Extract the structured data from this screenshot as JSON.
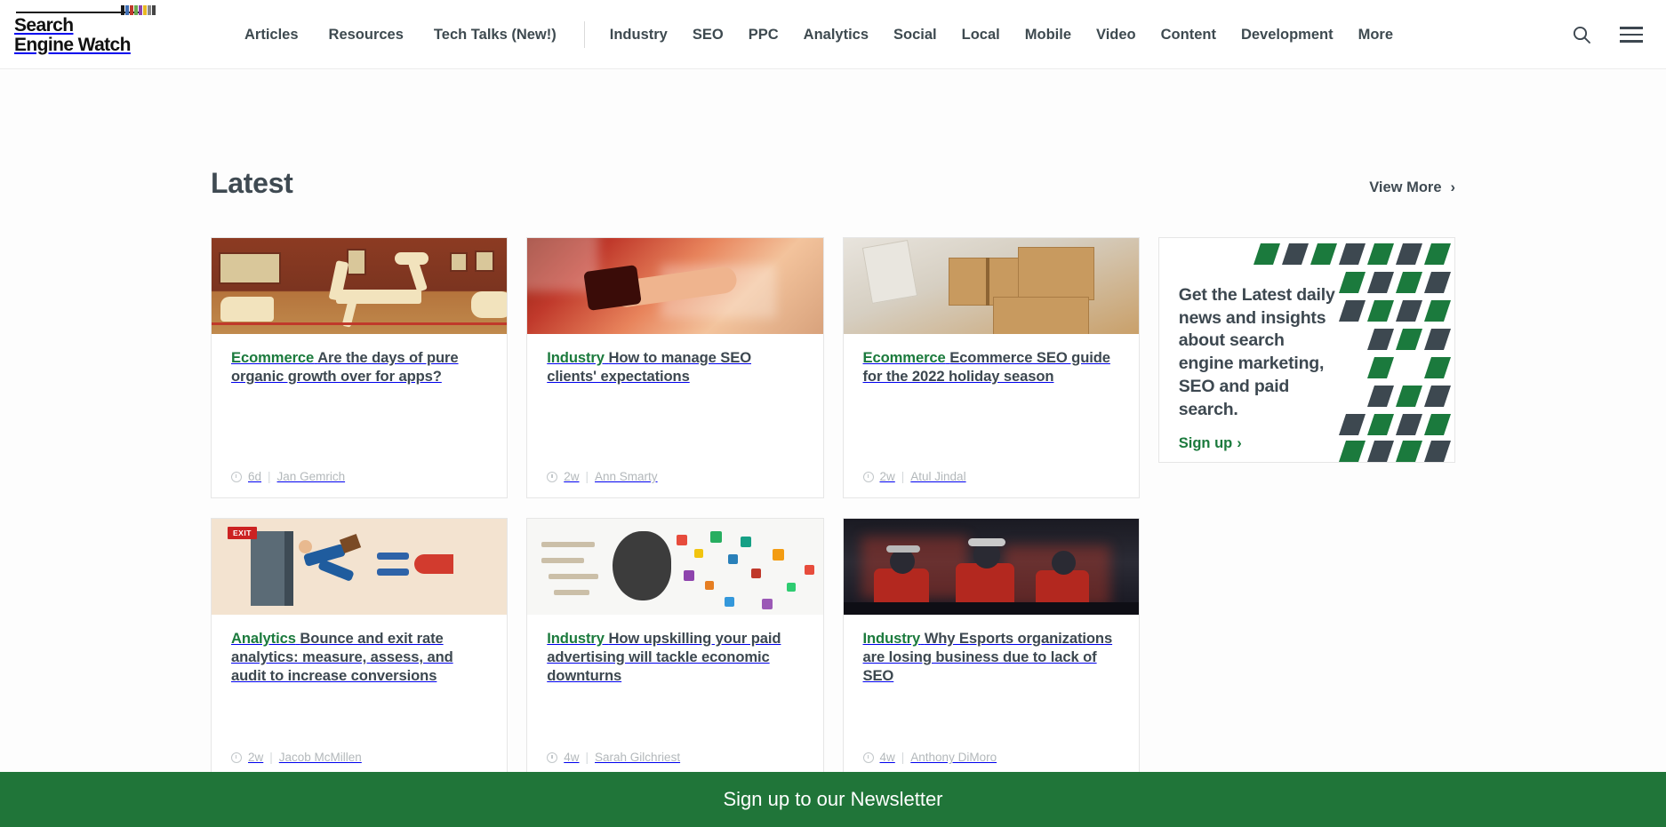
{
  "brand": {
    "name_line1": "Search",
    "name_line2": "Engine Watch",
    "accent_green": "#1b7a3d",
    "bar_colors": [
      "#1a1a1a",
      "#3f6fb5",
      "#c0392b",
      "#6aa84f",
      "#8e44ad",
      "#e8b923",
      "#888888",
      "#444444"
    ]
  },
  "header": {
    "primary_nav": [
      {
        "label": "Articles"
      },
      {
        "label": "Resources"
      },
      {
        "label": "Tech Talks (New!)"
      }
    ],
    "secondary_nav": [
      {
        "label": "Industry"
      },
      {
        "label": "SEO"
      },
      {
        "label": "PPC"
      },
      {
        "label": "Analytics"
      },
      {
        "label": "Social"
      },
      {
        "label": "Local"
      },
      {
        "label": "Mobile"
      },
      {
        "label": "Video"
      },
      {
        "label": "Content"
      },
      {
        "label": "Development"
      },
      {
        "label": "More"
      }
    ],
    "search_icon": "search-icon",
    "menu_icon": "hamburger-icon"
  },
  "main": {
    "section_title": "Latest",
    "view_more_label": "View More",
    "view_more_chevron": "›",
    "cards": [
      {
        "category": "Ecommerce",
        "title": "Are the days of pure organic growth over for apps?",
        "time": "6d",
        "separator": "|",
        "author": "Jan Gemrich",
        "thumb": "museum-dinosaur-skeletons"
      },
      {
        "category": "Industry",
        "title": "How to manage SEO clients' expectations",
        "time": "2w",
        "separator": "|",
        "author": "Ann Smarty",
        "thumb": "business-handshake"
      },
      {
        "category": "Ecommerce",
        "title": "Ecommerce SEO guide for the 2022 holiday season",
        "time": "2w",
        "separator": "|",
        "author": "Atul Jindal",
        "thumb": "cardboard-parcel-boxes"
      },
      {
        "category": "Analytics",
        "title": "Bounce and exit rate analytics: measure, assess, and audit to increase conversions",
        "time": "2w",
        "separator": "|",
        "author": "Jacob McMillen",
        "thumb": "exit-door-magnet-illustration",
        "thumb_badge": "EXIT"
      },
      {
        "category": "Industry",
        "title": "How upskilling your paid advertising will tackle economic downturns",
        "time": "4w",
        "separator": "|",
        "author": "Sarah Gilchriest",
        "thumb": "colorful-brain-ideas"
      },
      {
        "category": "Industry",
        "title": "Why Esports organizations are losing business due to lack of SEO",
        "time": "4w",
        "separator": "|",
        "author": "Anthony DiMoro",
        "thumb": "esports-gaming-team"
      }
    ],
    "promo": {
      "headline": "Get the Latest daily news and insights about search engine marketing, SEO and paid search.",
      "link_label": "Sign up",
      "link_chevron": "›",
      "pattern_colors": [
        "#1b7a3d",
        "#3d4850"
      ]
    }
  },
  "footer": {
    "newsletter_label": "Sign up to our Newsletter",
    "background": "#207539"
  }
}
